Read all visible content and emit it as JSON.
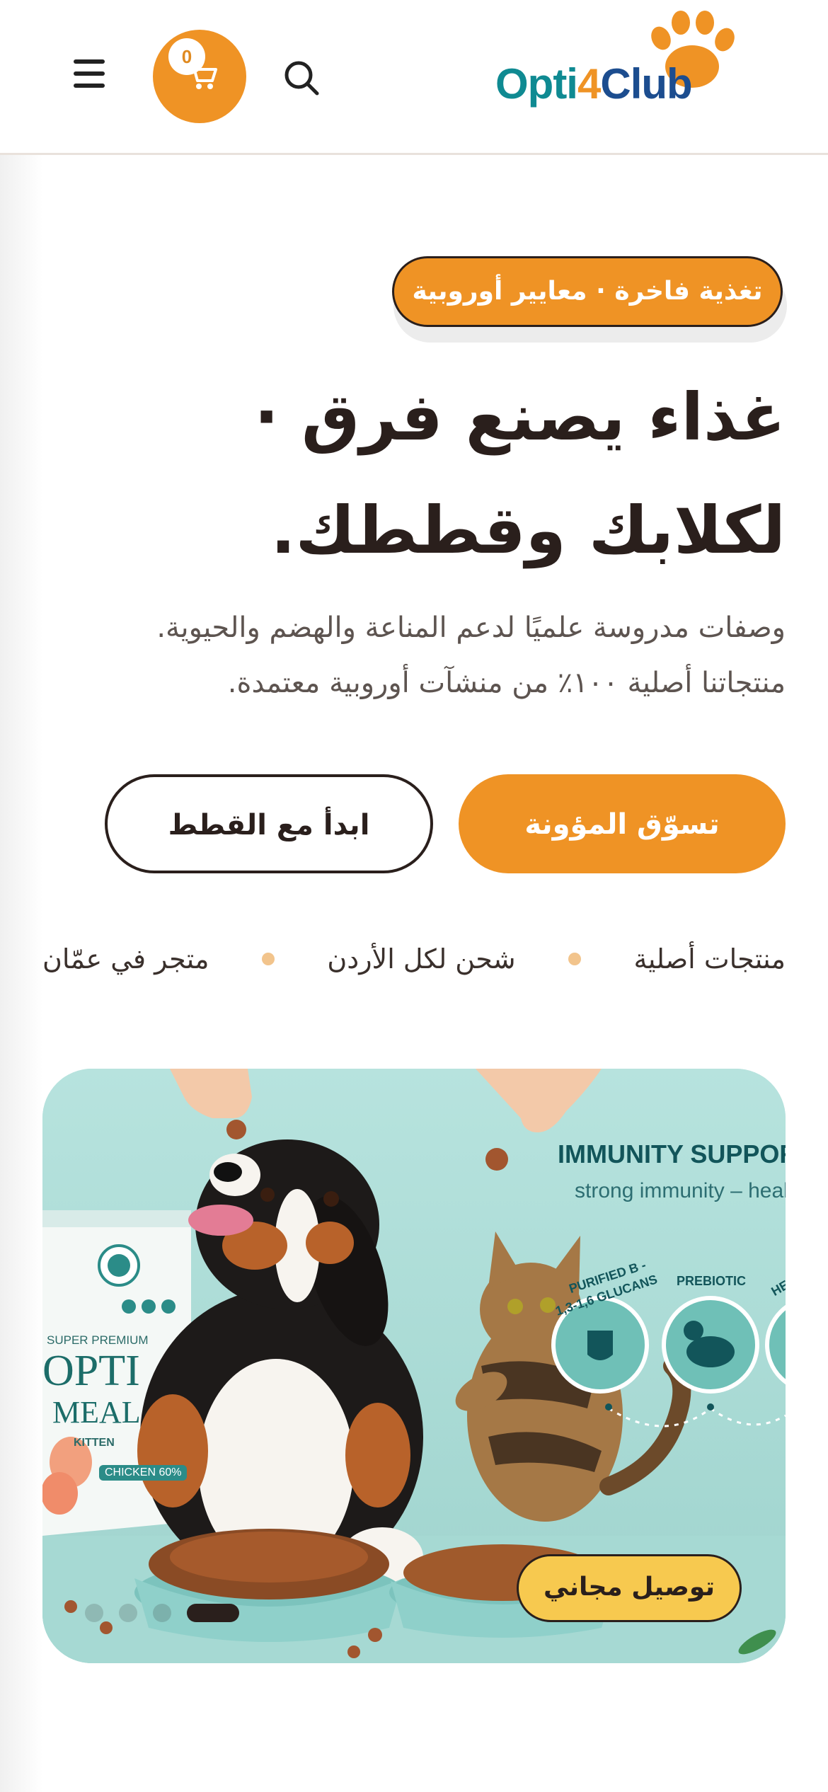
{
  "header": {
    "cart_count": "0",
    "logo": {
      "part1": "Opti",
      "part2": "4",
      "part3": "Club"
    }
  },
  "hero": {
    "badge": "تغذية فاخرة · معايير أوروبية",
    "title_line1": "غذاء يصنع فرق ·",
    "title_line2": "لكلابك وقططك.",
    "desc_line1": "وصفات مدروسة علميًا لدعم المناعة والهضم والحيوية.",
    "desc_line2": "منتجاتنا أصلية ١٠٠٪ من منشآت أوروبية معتمدة.",
    "primary_button": "تسوّق المؤونة",
    "secondary_button": "ابدأ مع القطط",
    "features": [
      "منتجات أصلية",
      "شحن لكل الأردن",
      "متجر في عمّان"
    ]
  },
  "banner": {
    "headline": "IMMUNITY SUPPOR",
    "subline": "strong immunity – heal",
    "pills": [
      "1,3-1,6 GLUCANS",
      "PREBIOTIC",
      "HE"
    ],
    "pill_arc_label": "PURIFIED B -",
    "bag": {
      "top_label": "SUPER PREMIUM",
      "brand": "OPTI",
      "product": "MEAL",
      "variant": "KITTEN",
      "flavor": "CHICKEN 60%"
    },
    "free_shipping": "توصيل مجاني",
    "slides_total": 4,
    "active_slide": 4
  },
  "colors": {
    "accent": "#ef9325",
    "dark": "#2a1f1c",
    "teal": "#0f8a92",
    "shipping_badge": "#f7c94f",
    "banner_bg": "#a9dcd7"
  },
  "icons": [
    "menu-icon",
    "cart-icon",
    "search-icon",
    "paw-icon"
  ]
}
